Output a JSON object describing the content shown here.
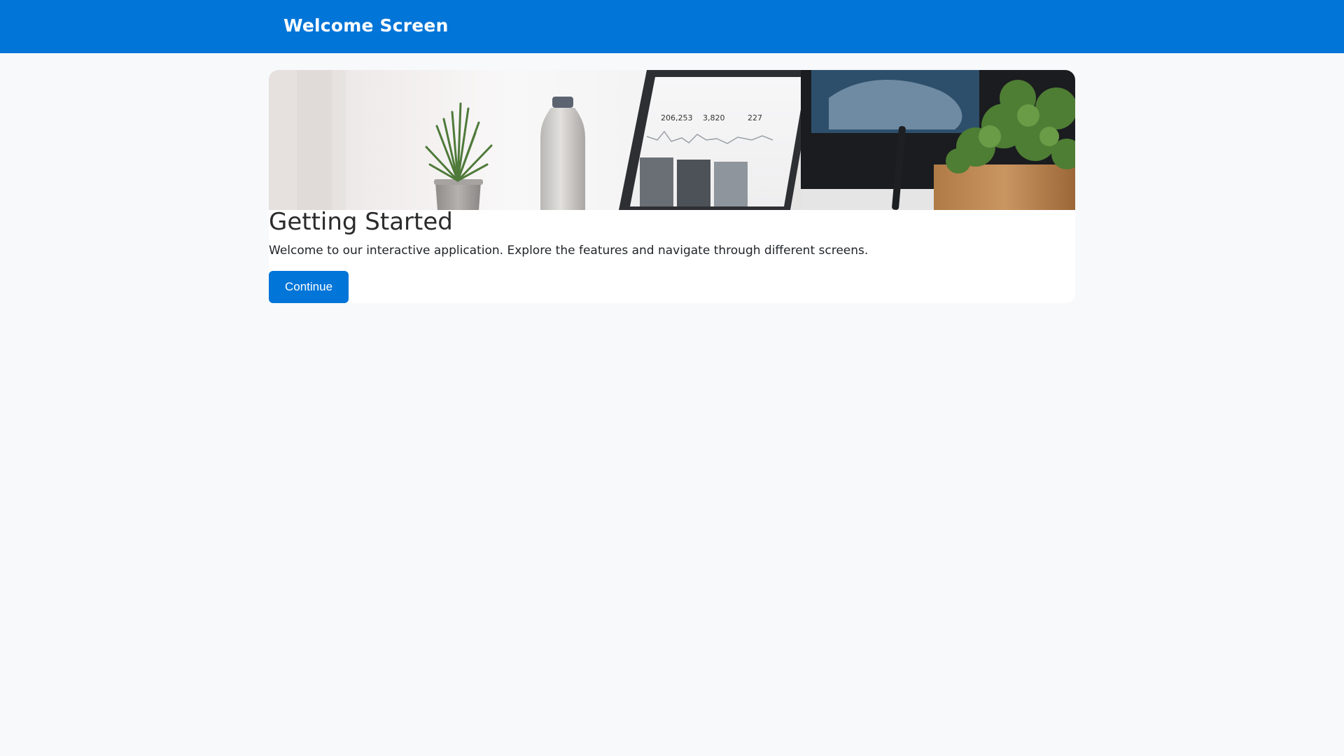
{
  "header": {
    "title": "Welcome Screen",
    "background_color": "#0275d8"
  },
  "card": {
    "hero_image": "workspace-photo",
    "title": "Getting Started",
    "description": "Welcome to our interactive application. Explore the features and navigate through different screens.",
    "continue_label": "Continue",
    "accent_color": "#0275d8"
  }
}
